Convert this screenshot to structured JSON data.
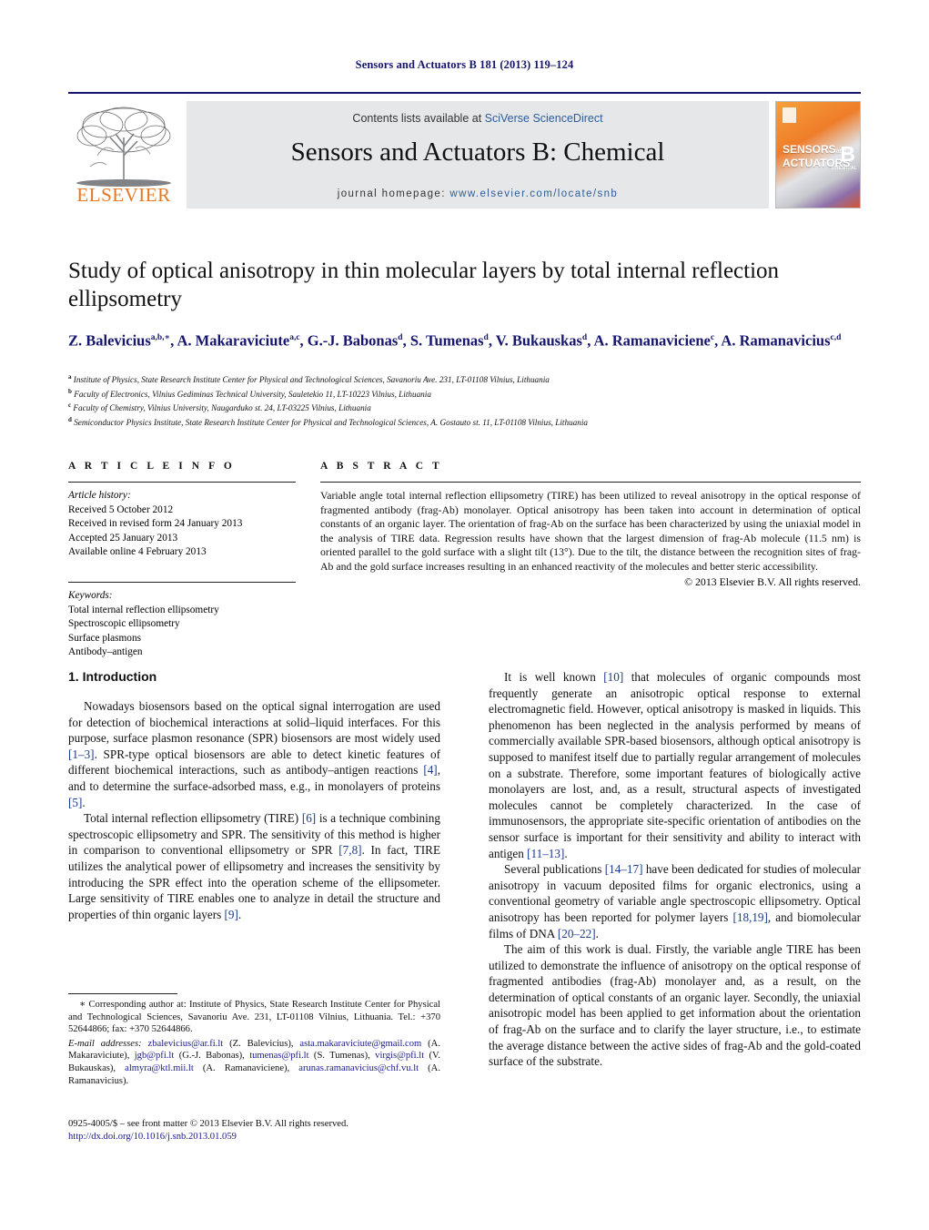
{
  "running_head": "Sensors and Actuators B 181 (2013) 119–124",
  "masthead": {
    "publisher_name": "ELSEVIER",
    "contents_prefix": "Contents lists available at ",
    "contents_link": "SciVerse ScienceDirect",
    "journal_title": "Sensors and Actuators B: Chemical",
    "homepage_label": "journal homepage: ",
    "homepage_url": "www.elsevier.com/locate/snb",
    "cover": {
      "line1": "SENSORS",
      "line1_small": "and",
      "line2": "ACTUATORS",
      "volume_letter": "B",
      "volume_sub": "CHEMICAL"
    }
  },
  "article": {
    "title": "Study of optical anisotropy in thin molecular layers by total internal reflection ellipsometry",
    "authors_html": "Z. Balevicius<sup>a,b,∗</sup>, A. Makaraviciute<sup>a,c</sup>, G.-J. Babonas<sup>d</sup>, S. Tumenas<sup>d</sup>, V. Bukauskas<sup>d</sup>, A. Ramanaviciene<sup>c</sup>, A. Ramanavicius<sup>c,d</sup>",
    "affiliations": [
      {
        "marker": "a",
        "text": "Institute of Physics, State Research Institute Center for Physical and Technological Sciences, Savanoriu Ave. 231, LT-01108 Vilnius, Lithuania"
      },
      {
        "marker": "b",
        "text": "Faculty of Electronics, Vilnius Gediminas Technical University, Sauletekio 11, LT-10223 Vilnius, Lithuania"
      },
      {
        "marker": "c",
        "text": "Faculty of Chemistry, Vilnius University, Naugarduko st. 24, LT-03225 Vilnius, Lithuania"
      },
      {
        "marker": "d",
        "text": "Semiconductor Physics Institute, State Research Institute Center for Physical and Technological Sciences, A. Gostauto st. 11, LT-01108 Vilnius, Lithuania"
      }
    ]
  },
  "article_info": {
    "heading": "A R T I C L E   I N F O",
    "history_label": "Article history:",
    "history": [
      "Received 5 October 2012",
      "Received in revised form 24 January 2013",
      "Accepted 25 January 2013",
      "Available online 4 February 2013"
    ],
    "keywords_label": "Keywords:",
    "keywords": [
      "Total internal reflection ellipsometry",
      "Spectroscopic ellipsometry",
      "Surface plasmons",
      "Antibody–antigen"
    ]
  },
  "abstract": {
    "heading": "A B S T R A C T",
    "text": "Variable angle total internal reflection ellipsometry (TIRE) has been utilized to reveal anisotropy in the optical response of fragmented antibody (frag-Ab) monolayer. Optical anisotropy has been taken into account in determination of optical constants of an organic layer. The orientation of frag-Ab on the surface has been characterized by using the uniaxial model in the analysis of TIRE data. Regression results have shown that the largest dimension of frag-Ab molecule (11.5 nm) is oriented parallel to the gold surface with a slight tilt (13°). Due to the tilt, the distance between the recognition sites of frag-Ab and the gold surface increases resulting in an enhanced reactivity of the molecules and better steric accessibility.",
    "copyright": "© 2013 Elsevier B.V. All rights reserved."
  },
  "introduction": {
    "heading": "1.  Introduction",
    "left_paragraphs": [
      "Nowadays biosensors based on the optical signal interrogation are used for detection of biochemical interactions at solid–liquid interfaces. For this purpose, surface plasmon resonance (SPR) biosensors are most widely used [1–3]. SPR-type optical biosensors are able to detect kinetic features of different biochemical interactions, such as antibody–antigen reactions [4], and to determine the surface-adsorbed mass, e.g., in monolayers of proteins [5].",
      "Total internal reflection ellipsometry (TIRE) [6] is a technique combining spectroscopic ellipsometry and SPR. The sensitivity of this method is higher in comparison to conventional ellipsometry or SPR [7,8]. In fact, TIRE utilizes the analytical power of ellipsometry and increases the sensitivity by introducing the SPR effect into the operation scheme of the ellipsometer. Large sensitivity of TIRE enables one to analyze in detail the structure and properties of thin organic layers [9]."
    ],
    "right_paragraphs": [
      "It is well known [10] that molecules of organic compounds most frequently generate an anisotropic optical response to external electromagnetic field. However, optical anisotropy is masked in liquids. This phenomenon has been neglected in the analysis performed by means of commercially available SPR-based biosensors, although optical anisotropy is supposed to manifest itself due to partially regular arrangement of molecules on a substrate. Therefore, some important features of biologically active monolayers are lost, and, as a result, structural aspects of investigated molecules cannot be completely characterized. In the case of immunosensors, the appropriate site-specific orientation of antibodies on the sensor surface is important for their sensitivity and ability to interact with antigen [11–13].",
      "Several publications [14–17] have been dedicated for studies of molecular anisotropy in vacuum deposited films for organic electronics, using a conventional geometry of variable angle spectroscopic ellipsometry. Optical anisotropy has been reported for polymer layers [18,19], and biomolecular films of DNA [20–22].",
      "The aim of this work is dual. Firstly, the variable angle TIRE has been utilized to demonstrate the influence of anisotropy on the optical response of fragmented antibodies (frag-Ab) monolayer and, as a result, on the determination of optical constants of an organic layer. Secondly, the uniaxial anisotropic model has been applied to get information about the orientation of frag-Ab on the surface and to clarify the layer structure, i.e., to estimate the average distance between the active sides of frag-Ab and the gold-coated surface of the substrate."
    ]
  },
  "footnote": {
    "corresponding": "∗ Corresponding author at: Institute of Physics, State Research Institute Center for Physical and Technological Sciences, Savanoriu Ave. 231, LT-01108 Vilnius, Lithuania. Tel.: +370 52644866; fax: +370 52644866.",
    "email_label": "E-mail addresses:",
    "emails": [
      {
        "address": "zbalevicius@ar.fi.lt",
        "owner": "(Z. Balevicius),"
      },
      {
        "address": "asta.makaraviciute@gmail.com",
        "owner": "(A. Makaraviciute),"
      },
      {
        "address": "jgb@pfi.lt",
        "owner": "(G.-J. Babonas),"
      },
      {
        "address": "tumenas@pfi.lt",
        "owner": "(S. Tumenas),"
      },
      {
        "address": "virgis@pfi.lt",
        "owner": "(V. Bukauskas),"
      },
      {
        "address": "almyra@ktl.mii.lt",
        "owner": "(A. Ramanaviciene),"
      },
      {
        "address": "arunas.ramanavicius@chf.vu.lt",
        "owner": "(A. Ramanavicius)."
      }
    ]
  },
  "footer": {
    "issn_line": "0925-4005/$ – see front matter © 2013 Elsevier B.V. All rights reserved.",
    "doi": "http://dx.doi.org/10.1016/j.snb.2013.01.059"
  },
  "colors": {
    "link_blue": "#1a1a8c",
    "citation_blue": "#1a3a8f",
    "elsevier_orange": "#E87722",
    "masthead_gray": "#e6e7e9"
  }
}
